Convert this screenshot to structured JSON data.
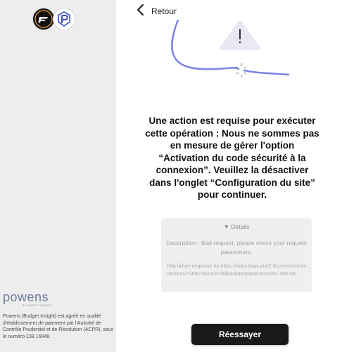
{
  "sidebar": {
    "brand_name": "powens",
    "brand_tagline": "BY BUDGET INSIGHT",
    "legal_text": "Powens (Budget Insight) est agréé en qualité d'établissement de paiement par l'Autorité de Contrôle Prudentiel et de Résolution (ACPR), sous le numéro CIB 16948."
  },
  "header": {
    "back_label": "Retour"
  },
  "main": {
    "message": "Une action est requise pour exécuter cette opération : Nous ne sommes pas en mesure de gérer l'option “Activation du code sécurité à la connexion”. Veuillez la désactiver dans l'onglet “Configuration du site” pour continuer.",
    "details": {
      "toggle_label": "▼ Détails",
      "description": "Description : Bad request, please check your request parameters.",
      "raw_error": "Http failure response for https://linary.biapi.pro/2.0/users/me/connections/71681?source=fallback&expand=sources: 400 OK"
    },
    "retry_label": "Réessayer"
  },
  "colors": {
    "accent_line": "#7b83e6",
    "warning_icon_bg": "#e9e9f5",
    "button_bg": "#1a1a1a",
    "brand": "#6e7d98"
  },
  "icons": {
    "back": "chevron-left-icon",
    "warning": "warning-triangle-icon",
    "logo_a": "bank-logo-icon",
    "logo_b": "powens-p-logo-icon"
  }
}
